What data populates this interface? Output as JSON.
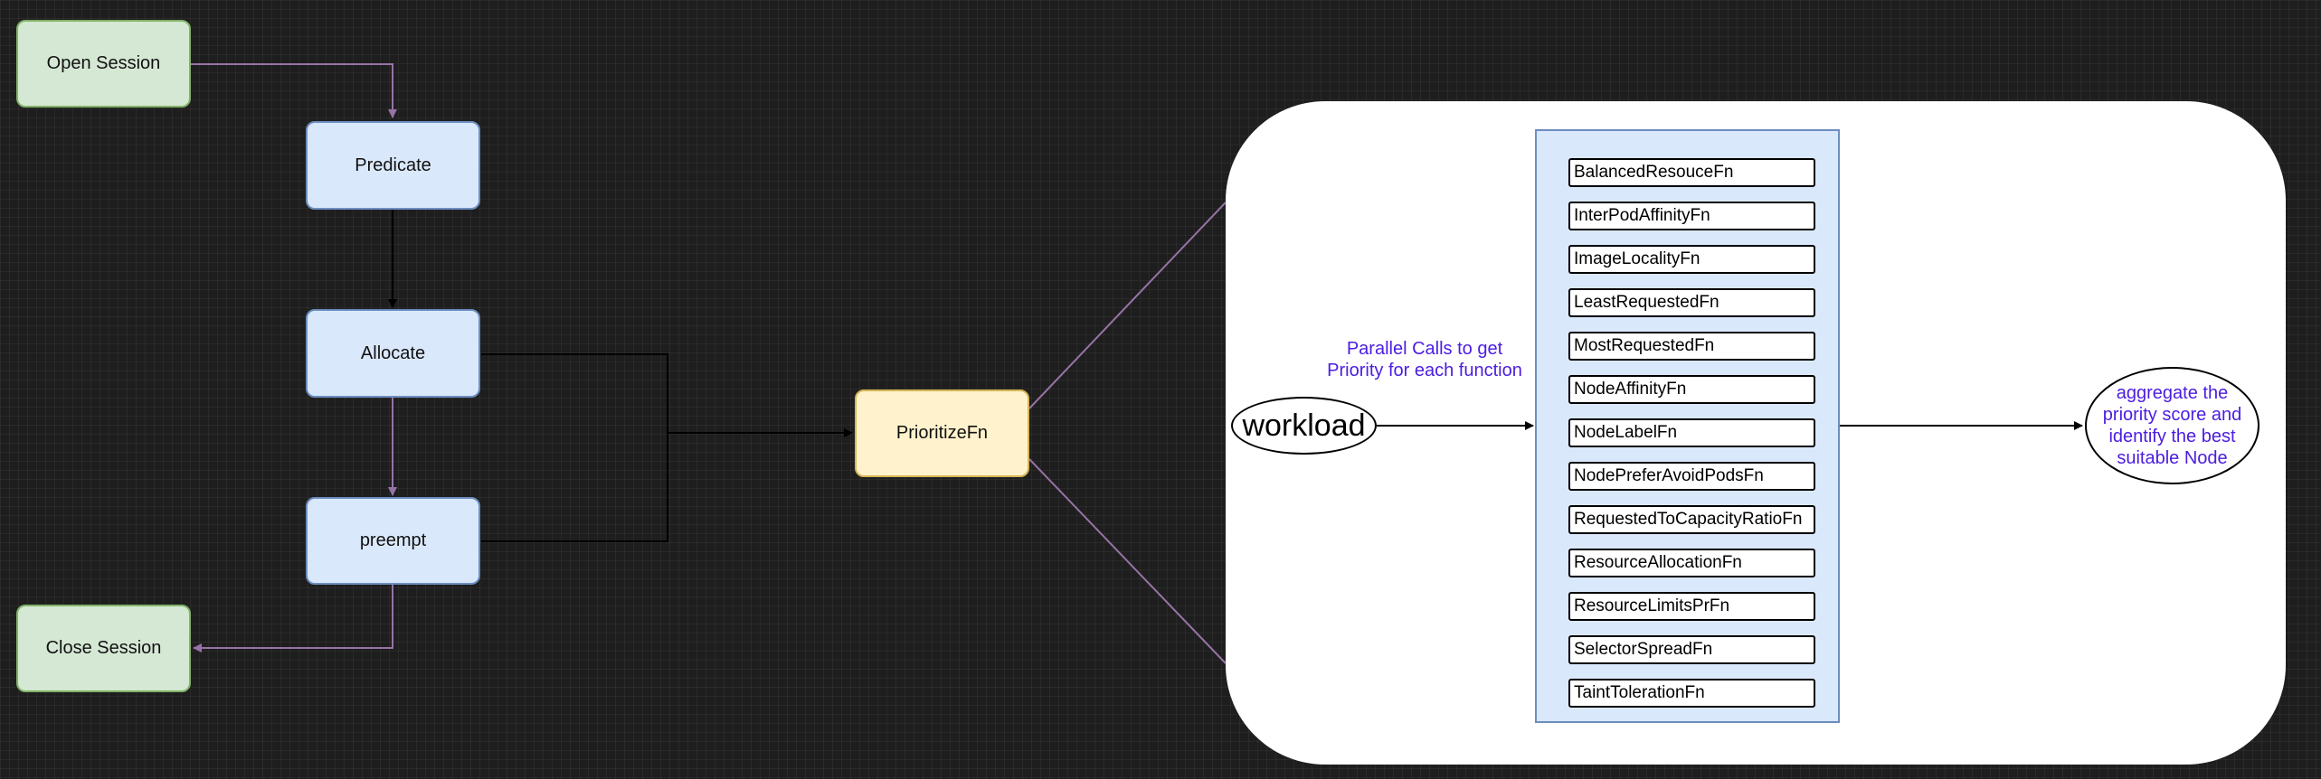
{
  "flow": {
    "open_session": "Open Session",
    "predicate": "Predicate",
    "allocate": "Allocate",
    "preempt": "preempt",
    "close_session": "Close Session",
    "prioritize": "PrioritizeFn"
  },
  "detail": {
    "workload": "workload",
    "parallel_label_line1": "Parallel Calls to get",
    "parallel_label_line2": "Priority for each function",
    "aggregate_line1": "aggregate the",
    "aggregate_line2": "priority score and",
    "aggregate_line3": "identify the best",
    "aggregate_line4": "suitable Node",
    "functions": [
      "BalancedResouceFn",
      "InterPodAffinityFn",
      "ImageLocalityFn",
      "LeastRequestedFn",
      "MostRequestedFn",
      "NodeAffinityFn",
      "NodeLabelFn",
      "NodePreferAvoidPodsFn",
      "RequestedToCapacityRatioFn",
      "ResourceAllocationFn",
      "ResourceLimitsPrFn",
      "SelectorSpreadFn",
      "TaintTolerationFn"
    ]
  },
  "colors": {
    "background": "#1e1e1e",
    "session_fill": "#d5e8d4",
    "step_fill": "#dae8fc",
    "prioritize_fill": "#fff2cc",
    "purple_edge": "#9673a6",
    "label_text": "#4c1ee0"
  }
}
